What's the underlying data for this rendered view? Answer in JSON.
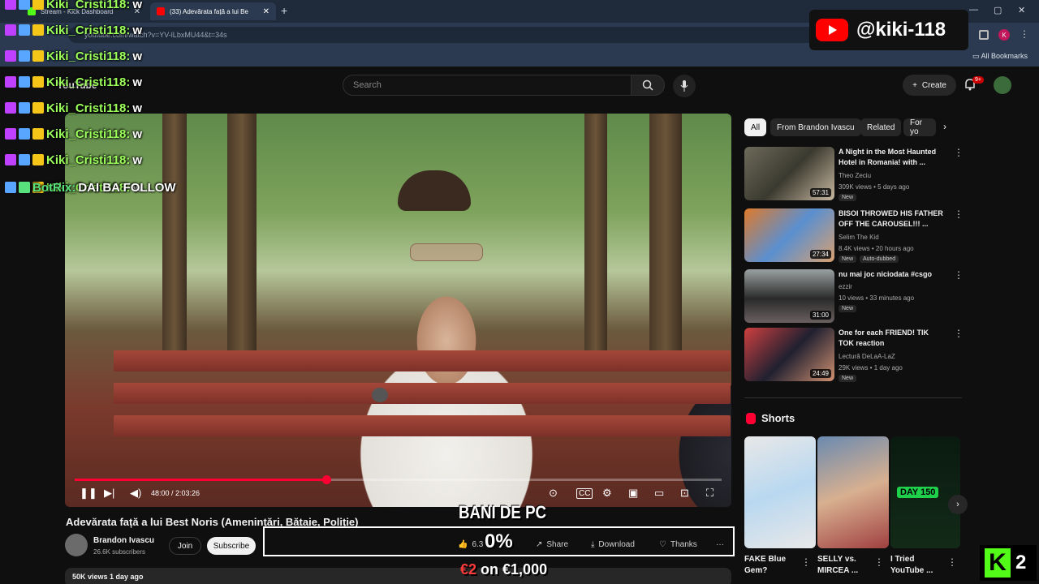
{
  "browser": {
    "tabs": [
      {
        "label": "Stream - Kick Dashboard",
        "active": false
      },
      {
        "label": "(33) Adevărata față a lui Be",
        "active": true
      }
    ],
    "new_tab": "+",
    "url": "youtube.com/watch?v=YV-lLbxMU44&t=34s",
    "all_bookmarks": "All Bookmarks",
    "profile_initial": "K"
  },
  "youtube": {
    "logo": "YouTube",
    "search_placeholder": "Search",
    "create_label": "Create",
    "notification_badge": "9+"
  },
  "video": {
    "time": "48:00 / 2:03:26",
    "progress": 0.389,
    "title": "Adevărata față a lui Best Noris (Amenințări, Bătaie, Poliție)",
    "channel": "Brandon Ivascu",
    "subscribers": "26.6K subscribers",
    "join_label": "Join",
    "subscribe_label": "Subscribe",
    "likes": "6.3",
    "share_label": "Share",
    "download_label": "Download",
    "thanks_label": "Thanks",
    "more_label": "···",
    "views_line": "50K views  1 day ago"
  },
  "sidebar": {
    "chips": [
      "All",
      "From Brandon Ivascu",
      "Related",
      "For yo"
    ],
    "recommendations": [
      {
        "title": "A Night in the Most Haunted Hotel in Romania! with ...",
        "channel": "Theo Zeciu",
        "meta": "309K views • 5 days ago",
        "badges": [
          "New"
        ],
        "duration": "57:31"
      },
      {
        "title": "BISOI THROWED HIS FATHER OFF THE CAROUSEL!!! ...",
        "channel": "Selim The Kid",
        "meta": "8.4K views • 20 hours ago",
        "badges": [
          "New",
          "Auto-dubbed"
        ],
        "duration": "27:34"
      },
      {
        "title": "nu mai joc niciodata #csgo",
        "channel": "ezzir",
        "meta": "10 views • 33 minutes ago",
        "badges": [
          "New"
        ],
        "duration": "31:00"
      },
      {
        "title": "One for each FRIEND! TIK TOK reaction",
        "channel": "Lectură DeLaA-LaZ",
        "meta": "29K views • 1 day ago",
        "badges": [
          "New"
        ],
        "duration": "24:49"
      }
    ],
    "shorts_heading": "Shorts",
    "shorts": [
      {
        "title": "FAKE Blue Gem?"
      },
      {
        "title": "SELLY vs. MIRCEA ..."
      },
      {
        "title": "I Tried YouTube ..."
      }
    ],
    "shorts_thumb_text": [
      "DAY 150"
    ]
  },
  "chat": [
    {
      "user": "Kiki_Cristi118:",
      "message": "w"
    },
    {
      "user": "Kiki_Cristi118:",
      "message": "w"
    },
    {
      "user": "Kiki_Cristi118:",
      "message": "w"
    },
    {
      "user": "Kiki_Cristi118:",
      "message": "w"
    },
    {
      "user": "Kiki_Cristi118:",
      "message": "w"
    },
    {
      "user": "Kiki_Cristi118:",
      "message": "w"
    },
    {
      "user": "Kiki_Cristi118:",
      "message": "w"
    },
    {
      "user": "Kiki_Cristi118:",
      "message": "w"
    },
    {
      "user": "BotRix:",
      "message": "DAI BA FOLLOW"
    }
  ],
  "overlay": {
    "handle": "@kiki-118",
    "goal_title": "BANI DE PC",
    "goal_percent": "0%",
    "goal_current": "€2",
    "goal_on": "on €1,000",
    "kick_count": "2",
    "kick_letter": "K"
  },
  "colors": {
    "accent_red": "#ff0033",
    "kick_green": "#53fc18",
    "chat_user": "#9cff5a"
  }
}
